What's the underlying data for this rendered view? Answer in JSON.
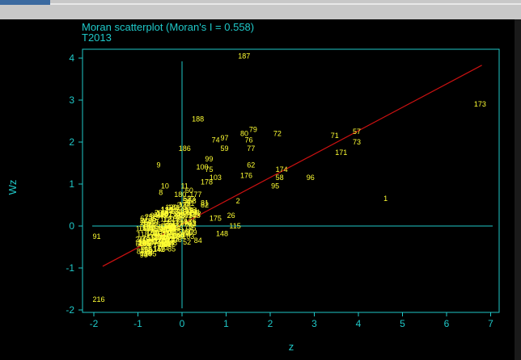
{
  "chart_data": {
    "type": "scatter",
    "title": "Moran scatterplot (Moran's I = 0.558)",
    "subtitle": "T2013",
    "xlabel": "z",
    "ylabel": "Wz",
    "xlim": [
      -2.1,
      7.2
    ],
    "ylim": [
      -2.2,
      4.3
    ],
    "xticks": [
      -2,
      -1,
      0,
      1,
      2,
      3,
      4,
      5,
      6,
      7
    ],
    "yticks": [
      -2,
      -1,
      0,
      1,
      2,
      3,
      4
    ],
    "reference_lines": {
      "x": 0,
      "y": 0
    },
    "regression_line": {
      "x": [
        -1.8,
        6.8
      ],
      "y": [
        -0.96,
        3.83
      ]
    },
    "colors": {
      "axis": "#1fc8c8",
      "points": "#ffff33",
      "regression": "#cc1111",
      "background": "#000000"
    },
    "points": [
      {
        "label": "187",
        "x": 1.4,
        "y": 4.05
      },
      {
        "label": "173",
        "x": 6.75,
        "y": 2.9
      },
      {
        "label": "188",
        "x": 0.35,
        "y": 2.55
      },
      {
        "label": "79",
        "x": 1.65,
        "y": 2.3
      },
      {
        "label": "80",
        "x": 1.45,
        "y": 2.2
      },
      {
        "label": "72",
        "x": 2.2,
        "y": 2.2
      },
      {
        "label": "57",
        "x": 4.0,
        "y": 2.25
      },
      {
        "label": "71",
        "x": 3.5,
        "y": 2.15
      },
      {
        "label": "73",
        "x": 4.0,
        "y": 2.0
      },
      {
        "label": "74",
        "x": 0.8,
        "y": 2.05
      },
      {
        "label": "97",
        "x": 1.0,
        "y": 2.1
      },
      {
        "label": "76",
        "x": 1.55,
        "y": 2.05
      },
      {
        "label": "186",
        "x": 0.05,
        "y": 1.85
      },
      {
        "label": "59",
        "x": 1.0,
        "y": 1.85
      },
      {
        "label": "77",
        "x": 1.6,
        "y": 1.85
      },
      {
        "label": "171",
        "x": 3.6,
        "y": 1.75
      },
      {
        "label": "99",
        "x": 0.65,
        "y": 1.6
      },
      {
        "label": "9",
        "x": -0.45,
        "y": 1.45
      },
      {
        "label": "62",
        "x": 1.6,
        "y": 1.45
      },
      {
        "label": "174",
        "x": 2.25,
        "y": 1.35
      },
      {
        "label": "100",
        "x": 0.45,
        "y": 1.4
      },
      {
        "label": "75",
        "x": 0.65,
        "y": 1.35
      },
      {
        "label": "103",
        "x": 0.75,
        "y": 1.15
      },
      {
        "label": "176",
        "x": 1.45,
        "y": 1.2
      },
      {
        "label": "58",
        "x": 2.25,
        "y": 1.15
      },
      {
        "label": "96",
        "x": 2.95,
        "y": 1.15
      },
      {
        "label": "95",
        "x": 2.15,
        "y": 0.95
      },
      {
        "label": "10",
        "x": -0.35,
        "y": 0.95
      },
      {
        "label": "11",
        "x": 0.1,
        "y": 0.95
      },
      {
        "label": "178",
        "x": 0.55,
        "y": 1.05
      },
      {
        "label": "8",
        "x": -0.4,
        "y": 0.8
      },
      {
        "label": "180",
        "x": -0.05,
        "y": 0.75
      },
      {
        "label": "60",
        "x": 0.2,
        "y": 0.85
      },
      {
        "label": "177",
        "x": 0.3,
        "y": 0.75
      },
      {
        "label": "63",
        "x": 0.15,
        "y": 0.65
      },
      {
        "label": "2",
        "x": 1.35,
        "y": 0.6
      },
      {
        "label": "1",
        "x": 4.7,
        "y": 0.65
      },
      {
        "label": "81",
        "x": 0.55,
        "y": 0.55
      },
      {
        "label": "3",
        "x": 0.15,
        "y": 0.45
      },
      {
        "label": "82",
        "x": 0.55,
        "y": 0.5
      },
      {
        "label": "26",
        "x": 1.15,
        "y": 0.25
      },
      {
        "label": "175",
        "x": 0.75,
        "y": 0.18
      },
      {
        "label": "115",
        "x": 1.2,
        "y": 0.0
      },
      {
        "label": "91",
        "x": -1.9,
        "y": -0.25
      },
      {
        "label": "148",
        "x": 0.9,
        "y": -0.18
      },
      {
        "label": "84",
        "x": 0.4,
        "y": -0.35
      },
      {
        "label": "52",
        "x": 0.15,
        "y": -0.38
      },
      {
        "label": "85",
        "x": -0.2,
        "y": -0.55
      },
      {
        "label": "216",
        "x": -1.9,
        "y": -1.75
      }
    ],
    "cluster_labels": [
      "12",
      "13",
      "14",
      "15",
      "16",
      "17",
      "18",
      "19",
      "20",
      "21",
      "22",
      "23",
      "24",
      "25",
      "27",
      "28",
      "29",
      "30",
      "31",
      "32",
      "33",
      "34",
      "35",
      "36",
      "37",
      "38",
      "39",
      "40",
      "41",
      "42",
      "43",
      "44",
      "45",
      "46",
      "47",
      "48",
      "49",
      "50",
      "51",
      "53",
      "54",
      "55",
      "56",
      "61",
      "64",
      "65",
      "66",
      "67",
      "68",
      "69",
      "70",
      "78",
      "83",
      "86",
      "87",
      "88",
      "89",
      "90",
      "92",
      "93",
      "94",
      "98",
      "101",
      "102",
      "104",
      "105",
      "106",
      "107",
      "108",
      "109",
      "110",
      "111",
      "112",
      "113",
      "114",
      "116",
      "117",
      "118",
      "119",
      "120",
      "121",
      "122",
      "123",
      "124",
      "125",
      "126",
      "127",
      "128",
      "129",
      "130",
      "131",
      "132",
      "133",
      "134",
      "135",
      "136",
      "137",
      "138",
      "139",
      "140",
      "141",
      "142",
      "143",
      "144",
      "145",
      "146",
      "147",
      "149",
      "150",
      "151",
      "152",
      "153",
      "154",
      "155",
      "156",
      "157",
      "158",
      "159",
      "160",
      "161",
      "162",
      "163",
      "164",
      "165",
      "166",
      "167",
      "168",
      "169",
      "170",
      "172",
      "179",
      "181",
      "182",
      "183",
      "184",
      "185",
      "189",
      "190",
      "191",
      "192",
      "193",
      "194",
      "195",
      "196",
      "197",
      "198",
      "199",
      "200",
      "201",
      "202",
      "203",
      "204",
      "205",
      "206",
      "207",
      "208",
      "209",
      "210",
      "211",
      "212",
      "213",
      "214",
      "215"
    ]
  }
}
